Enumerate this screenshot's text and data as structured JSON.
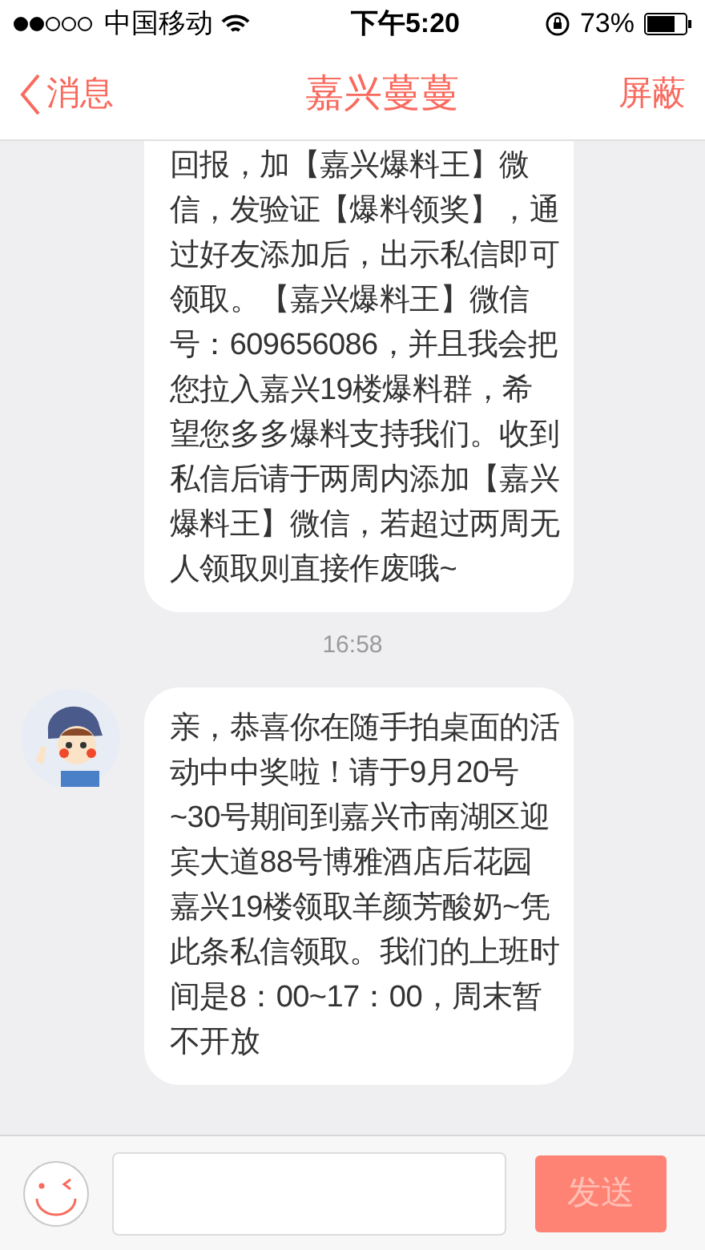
{
  "status_bar": {
    "carrier": "中国移动",
    "time": "下午5:20",
    "battery": "73%"
  },
  "nav": {
    "back": "消息",
    "title": "嘉兴蔓蔓",
    "action": "屏蔽"
  },
  "messages": [
    {
      "kind": "bubble",
      "avatar": false,
      "text": "回报，加【嘉兴爆料王】微信，发验证【爆料领奖】，通过好友添加后，出示私信即可领取。【嘉兴爆料王】微信号：609656086，并且我会把您拉入嘉兴19楼爆料群，希望您多多爆料支持我们。收到私信后请于两周内添加【嘉兴爆料王】微信，若超过两周无人领取则直接作废哦~"
    },
    {
      "kind": "time",
      "text": "16:58"
    },
    {
      "kind": "bubble",
      "avatar": true,
      "text": "亲，恭喜你在随手拍桌面的活动中中奖啦！请于9月20号~30号期间到嘉兴市南湖区迎宾大道88号博雅酒店后花园嘉兴19楼领取羊颜芳酸奶~凭此条私信领取。我们的上班时间是8：00~17：00，周末暂不开放"
    }
  ],
  "composer": {
    "send": "发送",
    "send_disabled": true
  }
}
